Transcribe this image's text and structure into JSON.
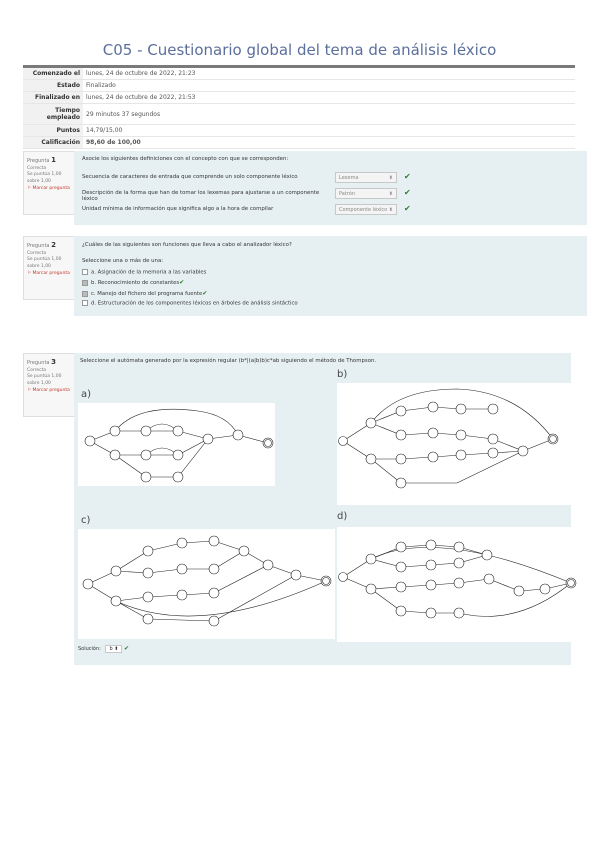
{
  "title": "C05 - Cuestionario global del tema de análisis léxico",
  "summary": {
    "rows": [
      {
        "label": "Comenzado el",
        "value": "lunes, 24 de octubre de 2022, 21:23"
      },
      {
        "label": "Estado",
        "value": "Finalizado"
      },
      {
        "label": "Finalizado en",
        "value": "lunes, 24 de octubre de 2022, 21:53"
      },
      {
        "label": "Tiempo empleado",
        "value": "29 minutos 37 segundos"
      },
      {
        "label": "Puntos",
        "value": "14,79/15,00"
      },
      {
        "label": "Calificación",
        "value": "98,60 de 100,00"
      }
    ]
  },
  "questions": [
    {
      "label": "Pregunta",
      "number": "1",
      "state": "Correcta",
      "score": "Se puntúa 1,00 sobre 1,00",
      "flag": "Marcar pregunta",
      "prompt": "Asocie los siguientes definiciones con el concepto con que se corresponden:",
      "rows": [
        {
          "text": "Secuencia de caracteres de entrada que comprende un solo componente léxico",
          "choice": "Lexema"
        },
        {
          "text": "Descripción de la forma que han de tomar los lexemas para ajustarse a un componente léxico",
          "choice": "Patrón"
        },
        {
          "text": "Unidad mínima de información que significa algo a la hora de compilar",
          "choice": "Componente léxico"
        }
      ]
    },
    {
      "label": "Pregunta",
      "number": "2",
      "state": "Correcta",
      "score": "Se puntúa 1,00 sobre 1,00",
      "flag": "Marcar pregunta",
      "prompt": "¿Cuáles de las siguientes son funciones que lleva a cabo el analizador léxico?",
      "instruction": "Seleccione una o más de una:",
      "options": [
        {
          "letter": "a.",
          "text": "Asignación de la memoria a las variables",
          "checked": false,
          "ok": false
        },
        {
          "letter": "b.",
          "text": "Reconocimiento de constantes",
          "checked": true,
          "ok": true
        },
        {
          "letter": "c.",
          "text": "Manejo del fichero del programa fuente",
          "checked": true,
          "ok": true
        },
        {
          "letter": "d.",
          "text": "Estructuración de los componentes léxicos en árboles de análisis sintáctico",
          "checked": false,
          "ok": false
        }
      ]
    },
    {
      "label": "Pregunta",
      "number": "3",
      "state": "Correcta",
      "score": "Se puntúa 1,00 sobre 1,00",
      "flag": "Marcar pregunta",
      "prompt": "Seleccione el autómata generado por la expresión regular (b*|(a|b)b)c*ab siguiendo el método de Thompson.",
      "diagram_labels": [
        "a)",
        "b)",
        "c)",
        "d)"
      ],
      "solution_label": "Solución:",
      "solution_value": "b"
    }
  ],
  "colors": {
    "title": "#5b6f9b",
    "panel": "#e6f0f3",
    "correct": "#2e7d32",
    "flag": "#c0392b"
  }
}
